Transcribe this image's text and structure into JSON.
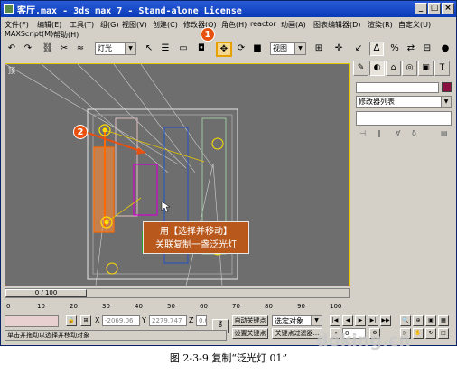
{
  "window": {
    "title": "客厅.max - 3ds max 7  - Stand-alone License",
    "controls": {
      "minimize": "_",
      "maximize": "□",
      "close": "×"
    }
  },
  "menu": {
    "row1": [
      "文件(F)",
      "编辑(E)",
      "工具(T)",
      "组(G)",
      "视图(V)",
      "创建(C)",
      "修改器(O)",
      "角色(H)",
      "reactor",
      "动画(A)",
      "图表编辑器(D)",
      "渲染(R)",
      "自定义(U)"
    ],
    "row2": [
      "MAXScript(M)",
      "帮助(H)"
    ]
  },
  "toolbar": {
    "selection_filter": "灯光",
    "ref_coord": "视图",
    "icons": [
      "undo-icon",
      "redo-icon",
      "link-icon",
      "unlink-icon",
      "bind-spacewarp-icon",
      "select-icon",
      "select-by-name-icon",
      "rect-region-icon",
      "window-crossing-icon",
      "select-move-icon",
      "select-rotate-icon",
      "select-scale-icon",
      "pivot-icon",
      "mirror-icon",
      "align-icon",
      "material-editor-icon",
      "render-icon"
    ]
  },
  "viewport": {
    "label": "顶",
    "callout": [
      "用【选择并移动】",
      "关联复制一盏泛光灯"
    ],
    "markers": {
      "move_tool": "1",
      "light": "2"
    },
    "colors": {
      "background": "#6e6e6e",
      "selected": "#ff6a00",
      "border_active": "#e8c800"
    }
  },
  "command_panel": {
    "tabs": [
      "create-icon",
      "modify-icon",
      "hierarchy-icon",
      "motion-icon",
      "display-icon",
      "utilities-icon"
    ],
    "object_name": "",
    "object_color": "#8a1040",
    "modifier_list": "修改器列表"
  },
  "timeline": {
    "slider": "0 / 100",
    "ticks": [
      "0",
      "10",
      "20",
      "30",
      "40",
      "50",
      "60",
      "70",
      "80",
      "90",
      "100"
    ]
  },
  "status": {
    "x_label": "X",
    "x_value": "-2069.06",
    "y_label": "Y",
    "y_value": "2279.747",
    "z_label": "Z",
    "z_value": "0.0",
    "prompt": "单击并拖动以选择并移动对象",
    "auto_key": "自动关键点",
    "set_key": "设置关键点",
    "key_filter_dropdown": "选定对象",
    "key_filters": "关键点过滤器...",
    "frame": "0"
  },
  "caption": "图 2-3-9   复制“泛光灯 01”",
  "watermark": "doking.cn"
}
